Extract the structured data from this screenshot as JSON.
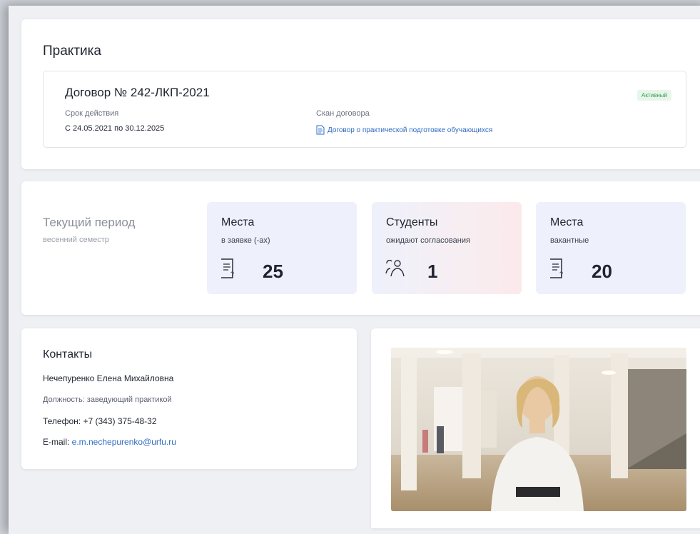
{
  "practice": {
    "title": "Практика",
    "contract": {
      "title": "Договор № 242-ЛКП-2021",
      "status": "Активный",
      "term_label": "Срок действия",
      "term_value": "С 24.05.2021 по 30.12.2025",
      "scan_label": "Скан договора",
      "scan_link": "Договор о практической подготовке обучающихся"
    }
  },
  "period": {
    "title": "Текущий период",
    "subtitle": "весенний семестр",
    "stats": [
      {
        "title": "Места",
        "subtitle": "в заявке (-ах)",
        "value": "25",
        "icon": "document-question-icon"
      },
      {
        "title": "Студенты",
        "subtitle": "ожидают согласования",
        "value": "1",
        "icon": "users-icon"
      },
      {
        "title": "Места",
        "subtitle": "вакантные",
        "value": "20",
        "icon": "document-question-icon"
      }
    ]
  },
  "contacts": {
    "title": "Контакты",
    "name": "Нечепуренко Елена Михайловна",
    "position": "Должность: заведующий практикой",
    "phone": "Телефон: +7 (343) 375-48-32",
    "email_label": "E-mail: ",
    "email": "e.m.nechepurenko@urfu.ru"
  },
  "colors": {
    "accent_link": "#2f6cc4",
    "badge_bg": "#e7f6ea",
    "badge_text": "#3a9a4e",
    "stat_bg": "#eef1fb"
  }
}
